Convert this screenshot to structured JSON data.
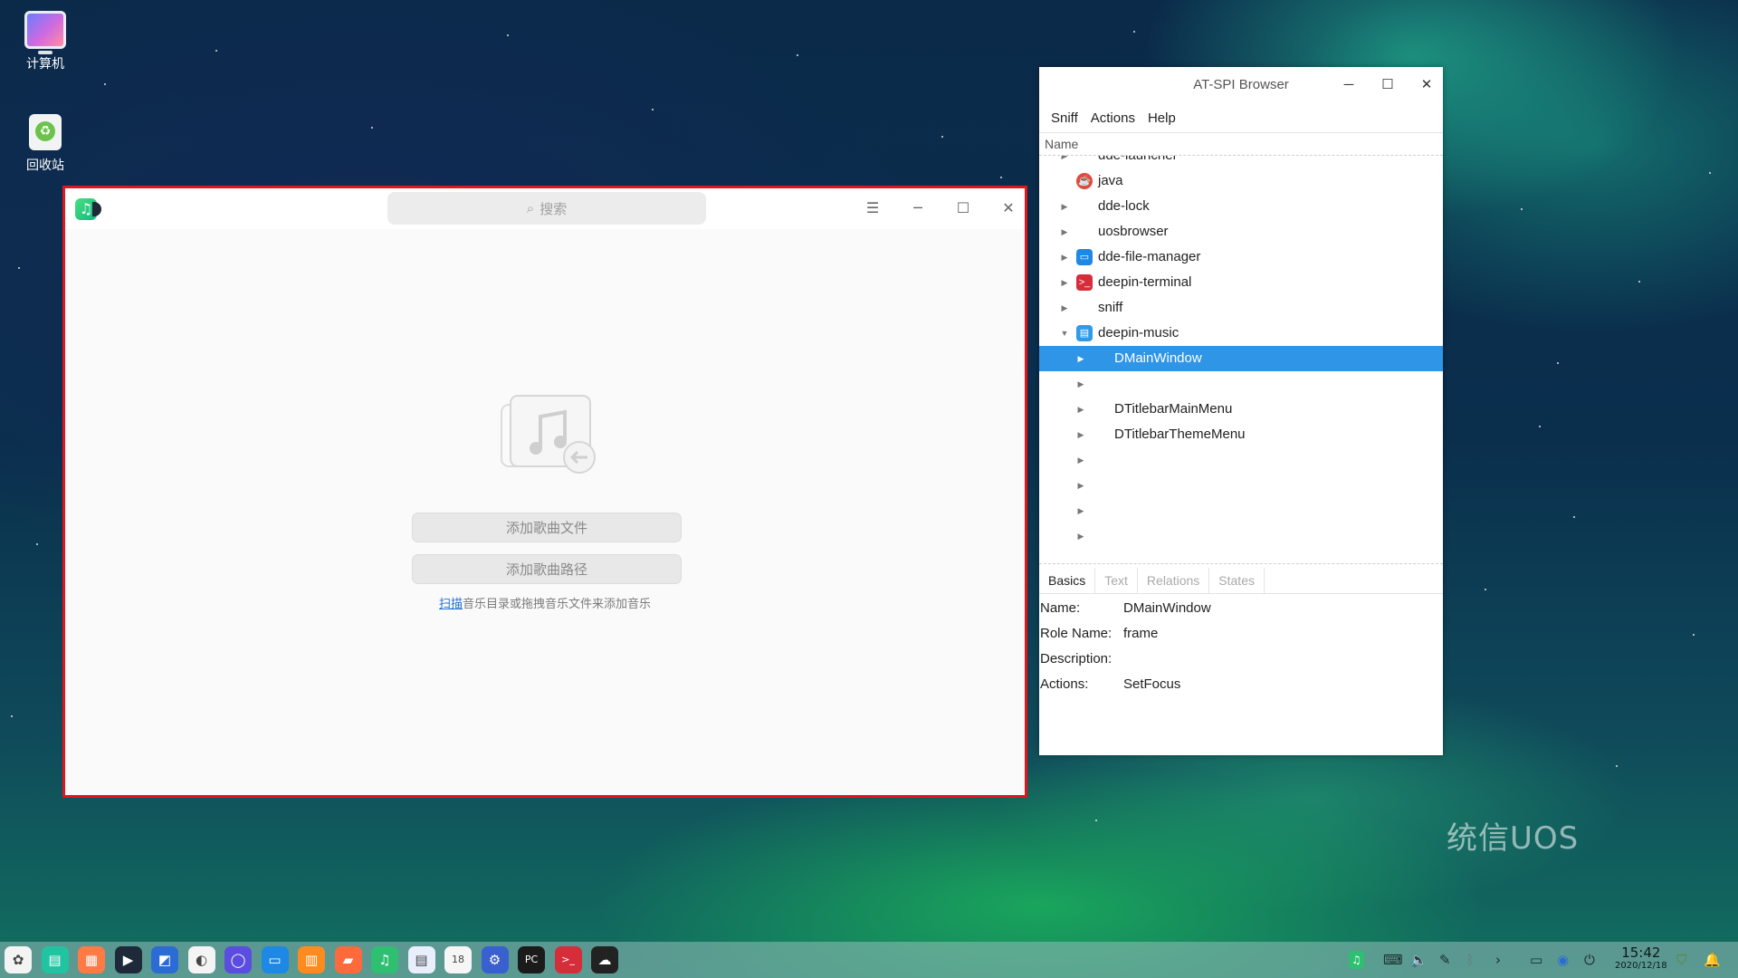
{
  "desktop": {
    "icons": [
      {
        "label": "计算机"
      },
      {
        "label": "回收站"
      }
    ],
    "watermark": "统信UOS"
  },
  "music_window": {
    "logo_icon": "music-note-icon",
    "search_placeholder": "搜索",
    "buttons": {
      "menu": "☰",
      "minimize": "─",
      "maximize": "☐",
      "close": "✕"
    },
    "add_files_label": "添加歌曲文件",
    "add_folder_label": "添加歌曲路径",
    "hint_link": "扫描",
    "hint_text": "音乐目录或拖拽音乐文件来添加音乐",
    "border_color": "#e0161c"
  },
  "atspi_window": {
    "title": "AT-SPI Browser",
    "menu": [
      "Sniff",
      "Actions",
      "Help"
    ],
    "column_header": "Name",
    "tree": [
      {
        "label": "dde-launcher",
        "level": 0,
        "expanded": false
      },
      {
        "label": "java",
        "level": 0,
        "expanded": false,
        "icon": "java-icon"
      },
      {
        "label": "dde-lock",
        "level": 0,
        "expanded": false
      },
      {
        "label": "uosbrowser",
        "level": 0,
        "expanded": false
      },
      {
        "label": "dde-file-manager",
        "level": 0,
        "expanded": false,
        "icon": "file-manager-icon"
      },
      {
        "label": "deepin-terminal",
        "level": 0,
        "expanded": false,
        "icon": "terminal-icon"
      },
      {
        "label": "sniff",
        "level": 0,
        "expanded": false
      },
      {
        "label": "deepin-music",
        "level": 0,
        "expanded": true,
        "icon": "music-app-icon"
      },
      {
        "label": "DMainWindow",
        "level": 1,
        "expanded": false,
        "selected": true
      },
      {
        "label": "",
        "level": 1,
        "expanded": false
      },
      {
        "label": "DTitlebarMainMenu",
        "level": 1,
        "expanded": false
      },
      {
        "label": "DTitlebarThemeMenu",
        "level": 1,
        "expanded": false
      },
      {
        "label": "",
        "level": 1,
        "expanded": false
      },
      {
        "label": "",
        "level": 1,
        "expanded": false
      },
      {
        "label": "",
        "level": 1,
        "expanded": false
      },
      {
        "label": "",
        "level": 1,
        "expanded": false
      }
    ],
    "tabs": [
      "Basics",
      "Text",
      "Relations",
      "States"
    ],
    "active_tab": "Basics",
    "properties": [
      {
        "key": "Name:",
        "value": "DMainWindow"
      },
      {
        "key": "Role Name:",
        "value": "frame"
      },
      {
        "key": "Description:",
        "value": ""
      },
      {
        "key": "Actions:",
        "value": "SetFocus"
      }
    ],
    "selection_color": "#2f95e6"
  },
  "dock": {
    "apps": [
      {
        "icon": "launcher-icon",
        "color": "#f4f4f4",
        "glyph": "✿"
      },
      {
        "icon": "multitask-view-icon",
        "color": "#22c3a0",
        "glyph": "▤"
      },
      {
        "icon": "app-store-icon",
        "color": "#ff7a45",
        "glyph": "▦"
      },
      {
        "icon": "video-player-icon",
        "color": "#1e2a3a",
        "glyph": "▶"
      },
      {
        "icon": "screenshot-icon",
        "color": "#2b6cd4",
        "glyph": "◩"
      },
      {
        "icon": "browser-icon",
        "color": "#f4f4f4",
        "glyph": "◐"
      },
      {
        "icon": "uos-browser-icon",
        "color": "#5b4de0",
        "glyph": "◯"
      },
      {
        "icon": "file-manager-icon",
        "color": "#1e88e5",
        "glyph": "▭"
      },
      {
        "icon": "app-store-orange-icon",
        "color": "#ff8a1e",
        "glyph": "▥"
      },
      {
        "icon": "image-viewer-icon",
        "color": "#ff6a3d",
        "glyph": "▰"
      },
      {
        "icon": "music-icon",
        "color": "#2fbf71",
        "glyph": "♫"
      },
      {
        "icon": "document-viewer-icon",
        "color": "#e8eefc",
        "glyph": "▤"
      },
      {
        "icon": "calendar-icon",
        "color": "#f6f6f6",
        "glyph": "18"
      },
      {
        "icon": "control-center-icon",
        "color": "#3a5fcf",
        "glyph": "⚙"
      },
      {
        "icon": "pycharm-icon",
        "color": "#1b1b1b",
        "glyph": "PC"
      },
      {
        "icon": "terminal-icon",
        "color": "#d62d3a",
        "glyph": ">_"
      },
      {
        "icon": "sniff-icon",
        "color": "#222222",
        "glyph": "☁"
      }
    ],
    "tray": [
      "music-tray-icon",
      "keyboard-icon",
      "volume-icon",
      "pen-icon",
      "bluetooth-icon",
      "chevron-right-icon",
      "display-icon",
      "network-icon",
      "power-icon"
    ],
    "clock_time": "15:42",
    "clock_date": "2020/12/18"
  }
}
